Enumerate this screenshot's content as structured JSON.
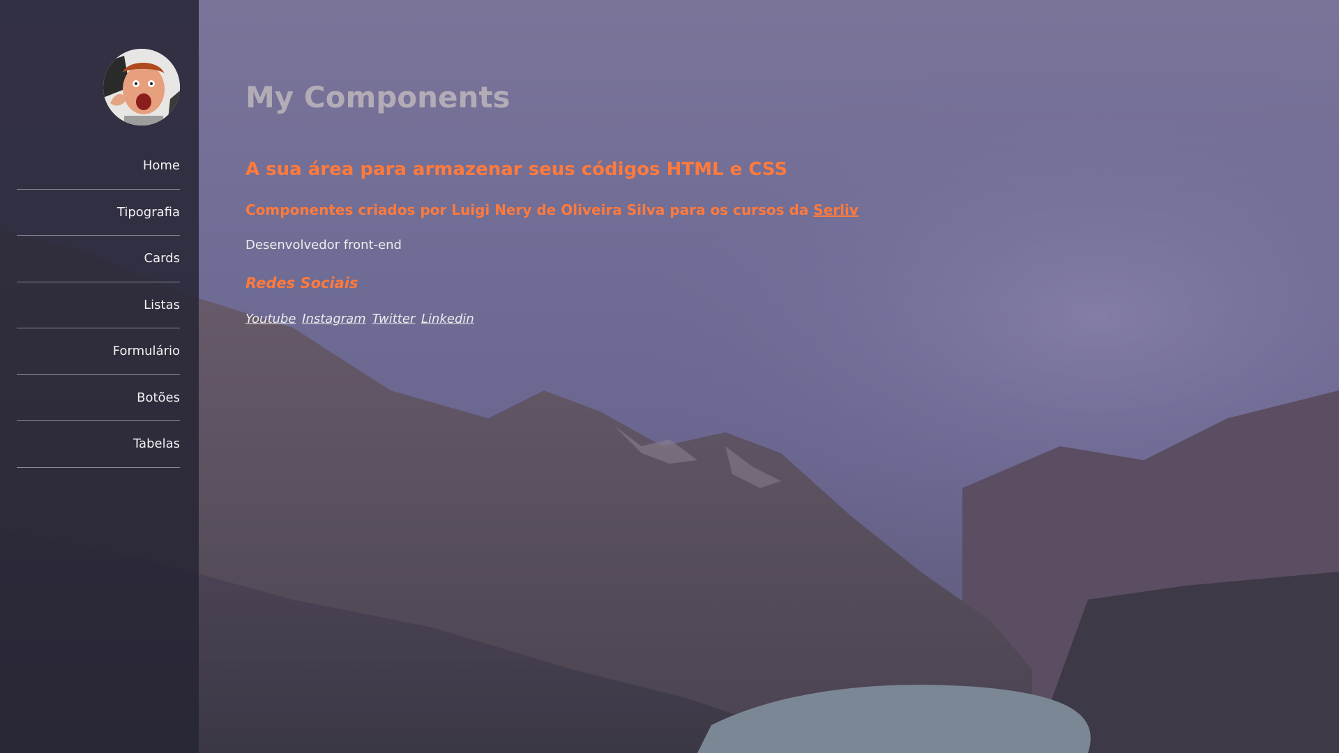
{
  "sidebar": {
    "avatar_alt": "profile photo",
    "items": [
      {
        "label": "Home"
      },
      {
        "label": "Tipografia"
      },
      {
        "label": "Cards"
      },
      {
        "label": "Listas"
      },
      {
        "label": "Formulário"
      },
      {
        "label": "Botões"
      },
      {
        "label": "Tabelas"
      }
    ]
  },
  "main": {
    "title": "My Components",
    "headline": "A sua área para armazenar seus códigos HTML e CSS",
    "subheadline_text": "Componentes criados por Luigi Nery de Oliveira Silva para os cursos da ",
    "subheadline_link": "Serliv",
    "role": "Desenvolvedor front-end",
    "social_title": "Redes Sociais",
    "social_links": [
      "Youtube",
      "Instagram",
      "Twitter",
      "Linkedin"
    ]
  },
  "colors": {
    "accent": "#ff7a3c",
    "title": "#b3acb7",
    "sidebar_bg": "#262534",
    "text_light": "#ececec"
  }
}
